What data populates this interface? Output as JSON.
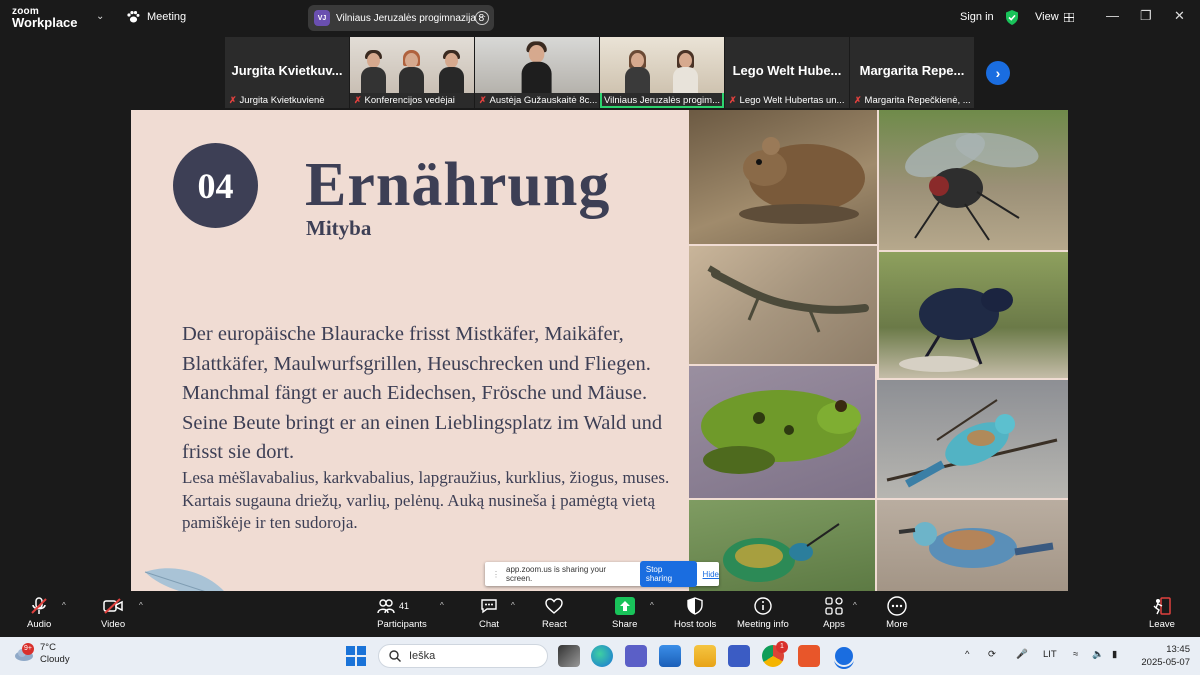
{
  "app": {
    "brand_line1": "zoom",
    "brand_line2": "Workplace",
    "meeting_label": "Meeting",
    "meeting_badge": "VJ",
    "meeting_name": "Vilniaus Jeruzalės progimnazija 8",
    "signin": "Sign in",
    "view": "View"
  },
  "participants": [
    {
      "big": "Jurgita  Kvietkuv...",
      "name": "Jurgita Kvietkuvienė",
      "muted": true,
      "video": false
    },
    {
      "big": "",
      "name": "Konferencijos vedėjai",
      "muted": true,
      "video": true
    },
    {
      "big": "",
      "name": "Austėja Gužauskaitė 8c...",
      "muted": true,
      "video": true
    },
    {
      "big": "",
      "name": "Vilniaus Jeruzalės progim...",
      "muted": false,
      "video": true,
      "active": true
    },
    {
      "big": "Lego  Welt  Hube...",
      "name": "Lego Welt Hubertas un...",
      "muted": true,
      "video": false
    },
    {
      "big": "Margarita  Repe...",
      "name": "Margarita Repečkienė, ...",
      "muted": true,
      "video": false
    }
  ],
  "slide": {
    "number": "04",
    "title": "Ernährung",
    "subtitle": "Mityba",
    "body_de": "Der europäische Blauracke frisst Mistkäfer, Maikäfer, Blattkäfer, Maulwurfsgrillen, Heuschrecken und Fliegen. Manchmal fängt er auch Eidechsen, Frösche und Mäuse. Seine Beute bringt er an einen Lieblingsplatz im Wald und frisst sie dort.",
    "body_lt": "Lesa mėšlavabalius, karkvabalius, lapgraužius, kurklius, žiogus, muses. Kartais sugauna driežų, varlių, pelėnų. Auką nusineša į pamėgtą vietą pamiškėje ir ten sudoroja."
  },
  "share_bar": {
    "text": "app.zoom.us is sharing your screen.",
    "stop": "Stop sharing",
    "hide": "Hide"
  },
  "toolbar": {
    "audio": "Audio",
    "video": "Video",
    "participants": "Participants",
    "participants_count": "41",
    "chat": "Chat",
    "react": "React",
    "share": "Share",
    "host_tools": "Host tools",
    "meeting_info": "Meeting info",
    "apps": "Apps",
    "more": "More",
    "leave": "Leave"
  },
  "taskbar": {
    "temp": "7°C",
    "weather": "Cloudy",
    "weather_badge": "9+",
    "search": "Ieška",
    "lang": "LIT",
    "time": "13:45",
    "date": "2025-05-07",
    "chrome_badge": "1"
  },
  "colors": {
    "accent": "#1a6de0",
    "slide_bg": "#f0dcd3",
    "slide_ink": "#3d3f55",
    "share_green": "#19c35a",
    "active_border": "#2dd36f",
    "mute_red": "#e0413e"
  }
}
